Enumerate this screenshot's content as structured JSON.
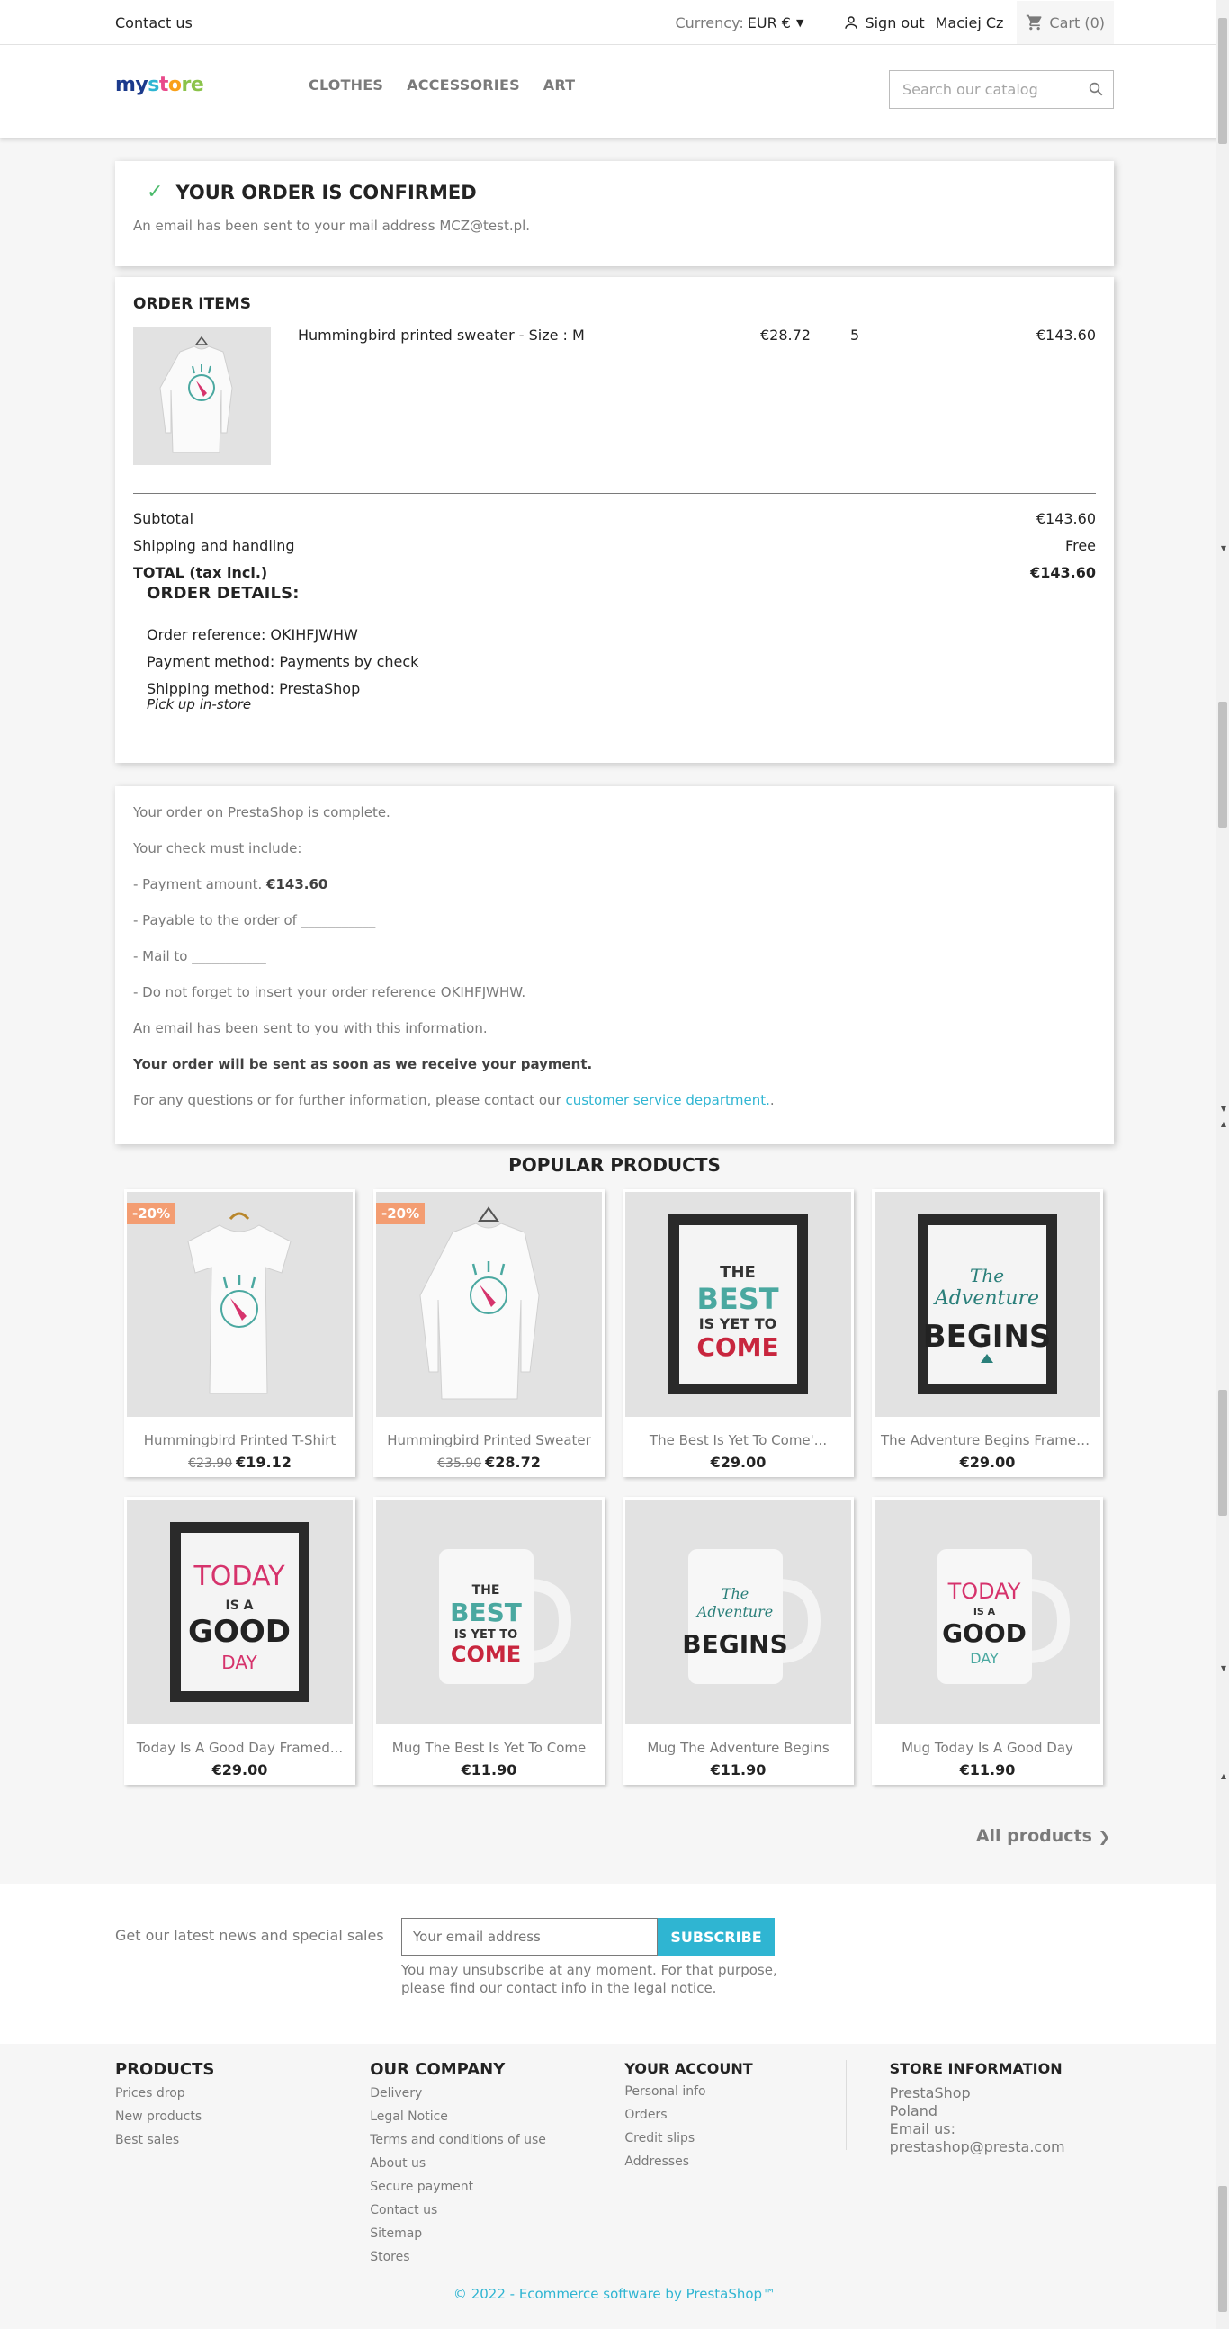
{
  "header": {
    "contact": "Contact us",
    "currency_label": "Currency:",
    "currency_value": "EUR €",
    "sign_out": "Sign out",
    "user_name": "Maciej Cz",
    "cart": "Cart (0)"
  },
  "logo": {
    "part1": "my ",
    "part2": "s",
    "part3": "t",
    "part4": "o",
    "part5": "re"
  },
  "menu": [
    "CLOTHES",
    "ACCESSORIES",
    "ART"
  ],
  "search": {
    "placeholder": "Search our catalog"
  },
  "confirmation": {
    "title": "YOUR ORDER IS CONFIRMED",
    "subtitle": "An email has been sent to your mail address MCZ@test.pl."
  },
  "order": {
    "items_title": "ORDER ITEMS",
    "item": {
      "name": "Hummingbird printed sweater - Size : M",
      "unit_price": "€28.72",
      "quantity": "5",
      "total": "€143.60"
    },
    "subtotal_label": "Subtotal",
    "subtotal_value": "€143.60",
    "shipping_label": "Shipping and handling",
    "shipping_value": "Free",
    "total_label": "TOTAL (tax incl.)",
    "total_value": "€143.60",
    "details_title": "ORDER DETAILS:",
    "reference": "Order reference: OKIHFJWHW",
    "payment": "Payment method: Payments by check",
    "shipping_method": "Shipping method: PrestaShop",
    "pickup": "Pick up in-store"
  },
  "check": {
    "complete": "Your order on PrestaShop is complete.",
    "include": "Your check must include:",
    "amount_prefix": "- Payment amount.",
    "amount_value": "€143.60",
    "payable": "- Payable to the order of ___________",
    "mail": "- Mail to ___________",
    "reference": "- Do not forget to insert your order reference OKIHFJWHW.",
    "email_sent": "An email has been sent to you with this information.",
    "sent_notice": "Your order will be sent as soon as we receive your payment.",
    "contact_prefix": "For any questions or for further information, please contact our ",
    "contact_link": "customer service department.",
    "contact_suffix": "."
  },
  "popular": {
    "title": "POPULAR PRODUCTS",
    "all_products": "All products",
    "products": [
      {
        "name": "Hummingbird Printed T-Shirt",
        "old_price": "€23.90",
        "price": "€19.12",
        "badge": "-20%"
      },
      {
        "name": "Hummingbird Printed Sweater",
        "old_price": "€35.90",
        "price": "€28.72",
        "badge": "-20%"
      },
      {
        "name": "The Best Is Yet To Come'...",
        "old_price": "",
        "price": "€29.00",
        "badge": ""
      },
      {
        "name": "The Adventure Begins Framed...",
        "old_price": "",
        "price": "€29.00",
        "badge": ""
      },
      {
        "name": "Today Is A Good Day Framed...",
        "old_price": "",
        "price": "€29.00",
        "badge": ""
      },
      {
        "name": "Mug The Best Is Yet To Come",
        "old_price": "",
        "price": "€11.90",
        "badge": ""
      },
      {
        "name": "Mug The Adventure Begins",
        "old_price": "",
        "price": "€11.90",
        "badge": ""
      },
      {
        "name": "Mug Today Is A Good Day",
        "old_price": "",
        "price": "€11.90",
        "badge": ""
      }
    ]
  },
  "newsletter": {
    "label": "Get our latest news and special sales",
    "placeholder": "Your email address",
    "button": "SUBSCRIBE",
    "note": "You may unsubscribe at any moment. For that purpose, please find our contact info in the legal notice."
  },
  "footer": {
    "products_title": "PRODUCTS",
    "products_links": [
      "Prices drop",
      "New products",
      "Best sales"
    ],
    "company_title": "OUR COMPANY",
    "company_links": [
      "Delivery",
      "Legal Notice",
      "Terms and conditions of use",
      "About us",
      "Secure payment",
      "Contact us",
      "Sitemap",
      "Stores"
    ],
    "account_title": "YOUR ACCOUNT",
    "account_links": [
      "Personal info",
      "Orders",
      "Credit slips",
      "Addresses"
    ],
    "store_title": "STORE INFORMATION",
    "store_lines": [
      "PrestaShop",
      "Poland",
      "Email us:",
      "prestashop@presta.com"
    ],
    "copyright": "© 2022 - Ecommerce software by PrestaShop™"
  },
  "colors": {
    "accent": "#2fb5d2",
    "badge": "#f39d72",
    "check": "#4cbb6c"
  }
}
